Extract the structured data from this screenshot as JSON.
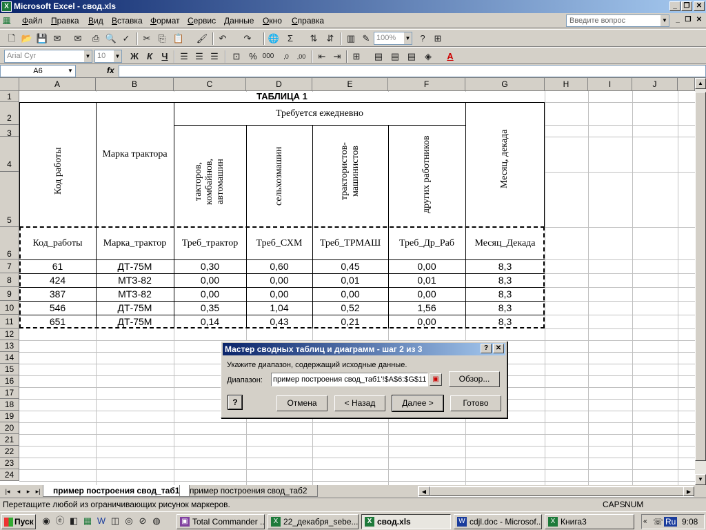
{
  "window": {
    "title": "Microsoft Excel - свод.xls"
  },
  "menu": {
    "items": [
      "Файл",
      "Правка",
      "Вид",
      "Вставка",
      "Формат",
      "Сервис",
      "Данные",
      "Окно",
      "Справка"
    ],
    "question_placeholder": "Введите вопрос"
  },
  "toolbar": {
    "zoom": "100%",
    "font_name": "Arial Cyr",
    "font_size": "10"
  },
  "formula_bar": {
    "name_box": "A6",
    "fx_label": "fx",
    "formula": ""
  },
  "sheet": {
    "columns": [
      "A",
      "B",
      "C",
      "D",
      "E",
      "F",
      "G",
      "H",
      "I",
      "J"
    ],
    "rows": [
      "1",
      "2",
      "3",
      "4",
      "5",
      "6",
      "7",
      "8",
      "9",
      "10",
      "11",
      "12",
      "13",
      "14",
      "15",
      "16",
      "17",
      "18",
      "19",
      "20",
      "21",
      "22",
      "23",
      "24"
    ],
    "table_title": "ТАБЛИЦА 1",
    "group_header": "Требуется ежедневно",
    "header_vertical": {
      "a": "Код работы",
      "c": "такторов, комбайнов, автомашин",
      "d": "сельхозмашин",
      "e": "трактористов-машинистов",
      "f": "других работников",
      "g": "Месяц, декада"
    },
    "header_b": "Марка трактора",
    "field_names": [
      "Код_работы",
      "Марка_трактор",
      "Треб_трактор",
      "Треб_СХМ",
      "Треб_ТРМАШ",
      "Треб_Др_Раб",
      "Месяц_Декада"
    ],
    "data_rows": [
      [
        "61",
        "ДТ-75М",
        "0,30",
        "0,60",
        "0,45",
        "0,00",
        "8,3"
      ],
      [
        "424",
        "МТЗ-82",
        "0,00",
        "0,00",
        "0,01",
        "0,01",
        "8,3"
      ],
      [
        "387",
        "МТЗ-82",
        "0,00",
        "0,00",
        "0,00",
        "0,00",
        "8,3"
      ],
      [
        "546",
        "ДТ-75М",
        "0,35",
        "1,04",
        "0,52",
        "1,56",
        "8,3"
      ],
      [
        "651",
        "ДТ-75М",
        "0,14",
        "0,43",
        "0,21",
        "0,00",
        "8,3"
      ]
    ]
  },
  "sheet_tabs": [
    "пример построения свод_таб1",
    "пример построения свод_таб2"
  ],
  "status": {
    "message": "Перетащите любой из ограничивающих рисунок маркеров.",
    "caps": "CAPS",
    "num": "NUM"
  },
  "dialog": {
    "title": "Мастер сводных таблиц и диаграмм - шаг 2 из 3",
    "prompt": "Укажите диапазон, содержащий исходные данные.",
    "range_label": "Диапазон:",
    "range_value": "пример построения свод_таб1'!$A$6:$G$11",
    "browse": "Обзор...",
    "cancel": "Отмена",
    "back": "< Назад",
    "next": "Далее >",
    "finish": "Готово"
  },
  "taskbar": {
    "start": "Пуск",
    "tasks": [
      "Total Commander ...",
      "22_декабря_sebe...",
      "свод.xls",
      "cdjl.doc - Microsof...",
      "Книга3"
    ],
    "lang": "Ru",
    "clock": "9:08"
  }
}
